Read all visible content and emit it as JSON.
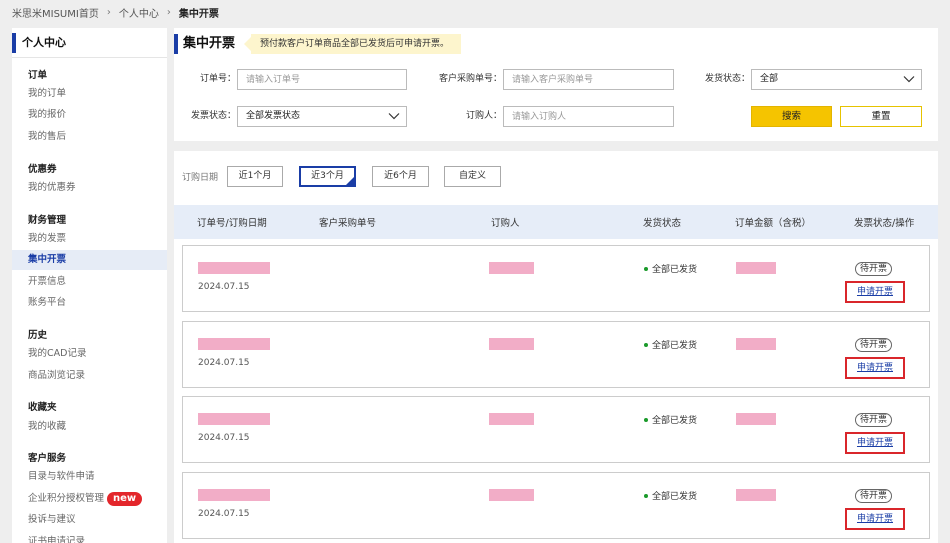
{
  "breadcrumb": {
    "items": [
      "米思米MISUMI首页",
      "个人中心"
    ],
    "current": "集中开票"
  },
  "sidebar": {
    "title": "个人中心",
    "groups": [
      {
        "title": "订单",
        "items": [
          "我的订单",
          "我的报价",
          "我的售后"
        ]
      },
      {
        "title": "优惠券",
        "items": [
          "我的优惠券"
        ]
      },
      {
        "title": "财务管理",
        "items": [
          "我的发票",
          "集中开票",
          "开票信息",
          "账务平台"
        ]
      },
      {
        "title": "历史",
        "items": [
          "我的CAD记录",
          "商品浏览记录"
        ]
      },
      {
        "title": "收藏夹",
        "items": [
          "我的收藏"
        ]
      },
      {
        "title": "客户服务",
        "items": [
          "目录与软件申请",
          "企业积分授权管理",
          "投诉与建议",
          "证书申请记录"
        ]
      }
    ],
    "active_item": "集中开票",
    "new_badge": "new"
  },
  "search": {
    "title": "集中开票",
    "notice": "预付款客户订单商品全部已发货后可申请开票。",
    "order_no_label": "订单号：",
    "order_no_placeholder": "请输入订单号",
    "po_no_label": "客户采购单号：",
    "po_no_placeholder": "请输入客户采购单号",
    "ship_status_label": "发货状态：",
    "ship_status_value": "全部",
    "invoice_status_label": "发票状态：",
    "invoice_status_value": "全部发票状态",
    "buyer_label": "订购人：",
    "buyer_placeholder": "请输入订购人",
    "search_button": "搜索",
    "reset_button": "重置"
  },
  "date_filter": {
    "label": "订购日期",
    "options": [
      "近1个月",
      "近3个月",
      "近6个月",
      "自定义"
    ],
    "selected": "近3个月"
  },
  "table": {
    "headers": [
      "订单号/订购日期",
      "客户采购单号",
      "订购人",
      "发货状态",
      "订单金额（含税）",
      "发票状态/操作"
    ],
    "rows": [
      {
        "date": "2024.07.15",
        "ship_status": "全部已发货",
        "invoice_status": "待开票",
        "action": "申请开票"
      },
      {
        "date": "2024.07.15",
        "ship_status": "全部已发货",
        "invoice_status": "待开票",
        "action": "申请开票"
      },
      {
        "date": "2024.07.15",
        "ship_status": "全部已发货",
        "invoice_status": "待开票",
        "action": "申请开票"
      },
      {
        "date": "2024.07.15",
        "ship_status": "全部已发货",
        "invoice_status": "待开票",
        "action": "申请开票"
      }
    ]
  },
  "colors": {
    "accent": "#1a3da6",
    "search_button": "#f5c400",
    "notice_bg": "#fdf5cd",
    "redacted": "#f2adc7",
    "highlight_box": "#d9262b",
    "new_badge": "#e3262b"
  }
}
